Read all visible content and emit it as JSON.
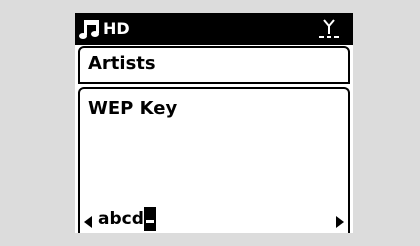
{
  "status_bar": {
    "source": "HD",
    "icons": [
      "music-notes-icon",
      "antenna-icon"
    ]
  },
  "menu": {
    "title": "Artists"
  },
  "content": {
    "field_label": "WEP Key",
    "entry_value": "abcd"
  },
  "colors": {
    "background": "#dcdcdc",
    "screen": "#ffffff",
    "foreground": "#000000"
  }
}
